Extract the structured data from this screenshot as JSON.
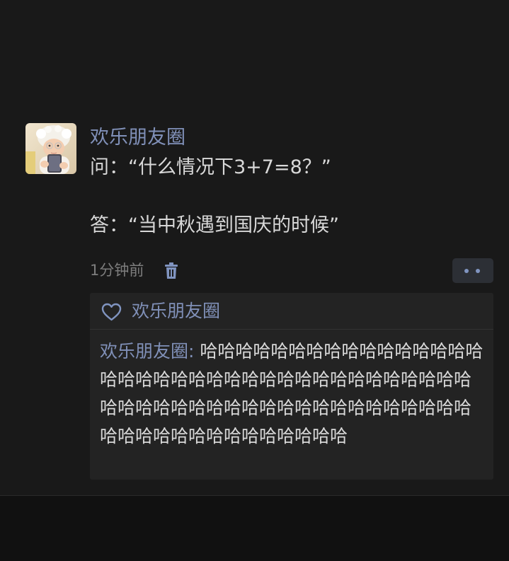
{
  "post": {
    "author": "欢乐朋友圈",
    "text": "问：“什么情况下3+7=8？”\n\n答：“当中秋遇到国庆的时候”",
    "time": "1分钟前",
    "avatar_icon": "baby-photo",
    "delete_icon": "trash-icon",
    "more_icon": "more-dots-icon"
  },
  "likes": {
    "icon": "heart-icon",
    "names": "欢乐朋友圈"
  },
  "comments": [
    {
      "author": "欢乐朋友圈",
      "separator": ": ",
      "text": "哈哈哈哈哈哈哈哈哈哈哈哈哈哈哈哈哈哈哈哈哈哈哈哈哈哈哈哈哈哈哈哈哈哈哈哈哈哈哈哈哈哈哈哈哈哈哈哈哈哈哈哈哈哈哈哈哈哈哈哈哈哈哈哈哈哈哈哈哈哈哈哈"
    }
  ],
  "colors": {
    "background": "#111111",
    "post_background": "#191919",
    "name": "#8090b8",
    "text": "#d8d8d8",
    "muted": "#7d7d7d",
    "box": "#232323"
  }
}
